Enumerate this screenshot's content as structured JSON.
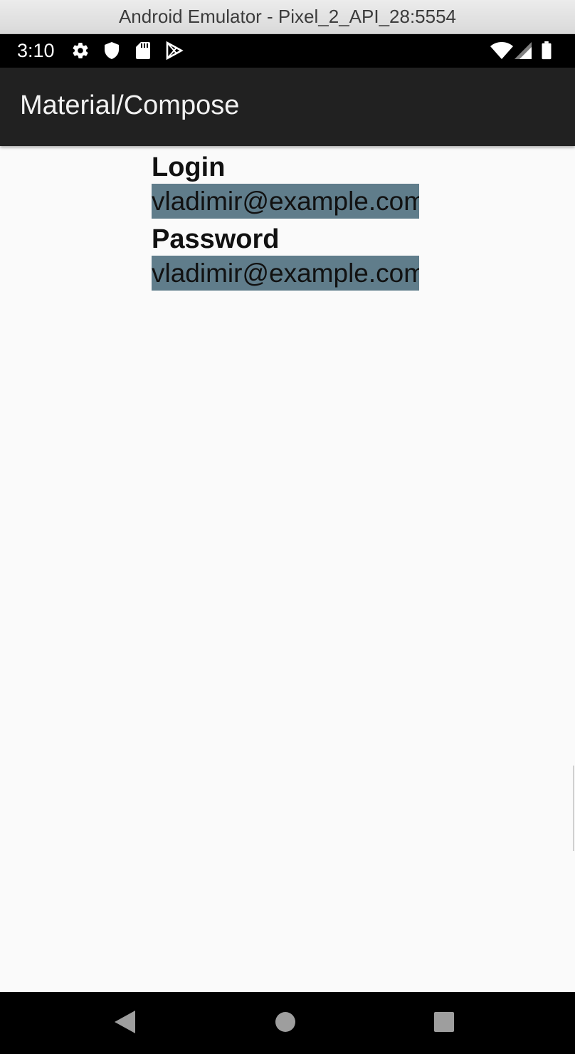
{
  "window": {
    "title": "Android Emulator - Pixel_2_API_28:5554"
  },
  "status_bar": {
    "time": "3:10",
    "left_icons": [
      "gear-icon",
      "shield-icon",
      "sd-card-icon",
      "play-store-icon"
    ],
    "right_icons": [
      "wifi-icon",
      "cell-signal-icon",
      "battery-icon"
    ]
  },
  "app_bar": {
    "title": "Material/Compose"
  },
  "form": {
    "login_label": "Login",
    "login_value": "vladimir@example.com",
    "password_label": "Password",
    "password_value": "vladimir@example.com"
  },
  "colors": {
    "input_background": "#607d8b",
    "app_bar": "#212121",
    "background": "#fafafa"
  },
  "nav_bar": {
    "buttons": [
      "back-icon",
      "home-icon",
      "recents-icon"
    ]
  }
}
